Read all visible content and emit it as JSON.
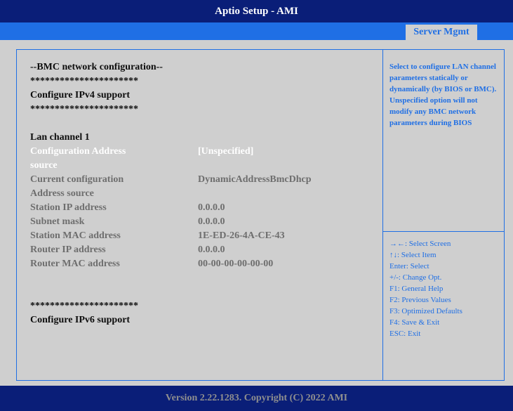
{
  "header": {
    "title": "Aptio Setup - AMI"
  },
  "tabs": {
    "active": "Server Mgmt"
  },
  "left": {
    "section_title": "--BMC network configuration--",
    "stars_1": "**********************",
    "ipv4_title": "Configure IPv4 support",
    "stars_2": "**********************",
    "lan_channel": "Lan channel 1",
    "config_source": {
      "label_1": "Configuration Address",
      "label_2": "source",
      "value": "[Unspecified]"
    },
    "current_config": {
      "label_1": "Current configuration",
      "label_2": "Address source",
      "value": "DynamicAddressBmcDhcp"
    },
    "station_ip": {
      "label": "Station IP address",
      "value": "0.0.0.0"
    },
    "subnet_mask": {
      "label": "Subnet mask",
      "value": "0.0.0.0"
    },
    "station_mac": {
      "label": "Station MAC address",
      "value": "1E-ED-26-4A-CE-43"
    },
    "router_ip": {
      "label": "Router IP address",
      "value": "0.0.0.0"
    },
    "router_mac": {
      "label": "Router MAC address",
      "value": "00-00-00-00-00-00"
    },
    "stars_3": "**********************",
    "ipv6_title": "Configure IPv6 support"
  },
  "help": {
    "text": "Select to configure LAN channel parameters statically or dynamically (by BIOS or BMC). Unspecified option will not modify any BMC network parameters during BIOS"
  },
  "keys": [
    "→←: Select Screen",
    "↑↓: Select Item",
    "Enter: Select",
    "+/-: Change Opt.",
    "F1: General Help",
    "F2: Previous Values",
    "F3: Optimized Defaults",
    "F4: Save & Exit",
    "ESC: Exit"
  ],
  "footer": {
    "text": "Version 2.22.1283. Copyright (C) 2022 AMI"
  },
  "colors": {
    "dark_blue": "#0a1e78",
    "accent_blue": "#1f6fe5",
    "panel_gray": "#cfcfcf",
    "selected_text": "#ffffff",
    "disabled_text": "#6e6e6e"
  }
}
